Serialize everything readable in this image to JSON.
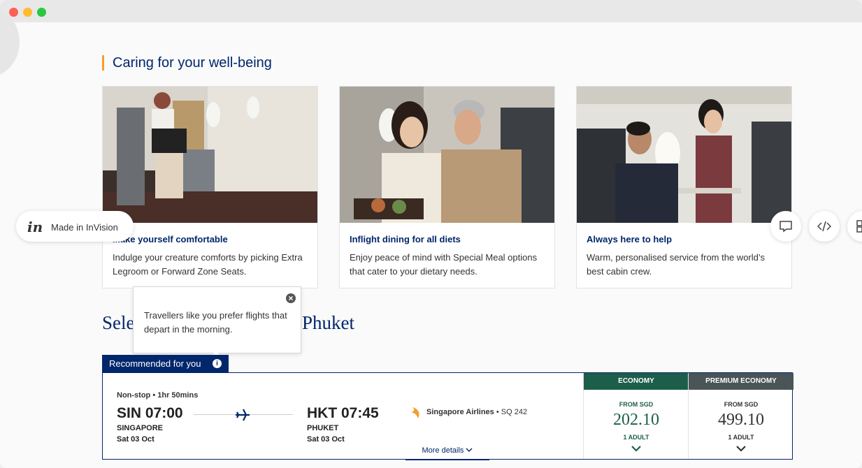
{
  "wellbeing": {
    "title": "Caring for your well-being",
    "cards": [
      {
        "title": "Make yourself comfortable",
        "desc": "Indulge your creature comforts by picking Extra Legroom or Forward Zone Seats."
      },
      {
        "title": "Inflight dining for all diets",
        "desc": "Enjoy peace of mind with Special Meal options that cater to your dietary needs."
      },
      {
        "title": "Always here to help",
        "desc": "Warm, personalised service from the world’s best cabin crew."
      }
    ]
  },
  "invision": {
    "logo": "in",
    "label": "Made in InVision"
  },
  "tools": {
    "icons": [
      "comment-icon",
      "code-icon",
      "grid-icon"
    ]
  },
  "select": {
    "title_start": "Sele",
    "title_end": "Phuket"
  },
  "tooltip": {
    "text": "Travellers like you prefer flights that depart in the morning."
  },
  "recommended": {
    "label": "Recommended for you",
    "info": "i"
  },
  "flight": {
    "duration": "Non-stop • 1hr 50mins",
    "departure": {
      "time": "SIN 07:00",
      "city": "SINGAPORE",
      "date": "Sat 03 Oct"
    },
    "arrival": {
      "time": "HKT 07:45",
      "city": "PHUKET",
      "date": "Sat 03 Oct"
    },
    "airline": "Singapore Airlines",
    "flight_no": " • SQ 242",
    "more": "More details"
  },
  "fares": [
    {
      "cabin": "ECONOMY",
      "from": "FROM SGD",
      "price": "202.10",
      "pax": "1 ADULT",
      "color": "#1d5e4a"
    },
    {
      "cabin": "PREMIUM ECONOMY",
      "from": "FROM SGD",
      "price": "499.10",
      "pax": "1 ADULT",
      "color": "#4a5557"
    }
  ],
  "colors": {
    "navy": "#00266b",
    "accent": "#f0a030"
  }
}
